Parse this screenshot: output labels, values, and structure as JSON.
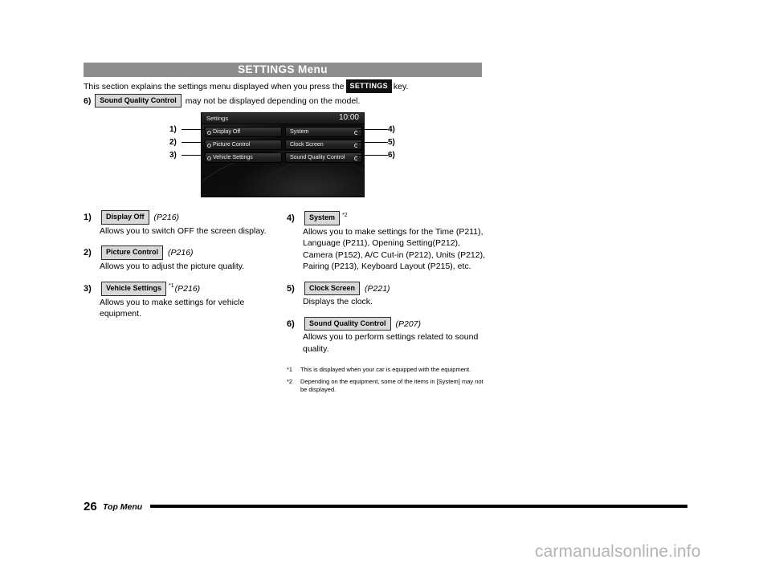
{
  "header": {
    "title": "SETTINGS Menu"
  },
  "intro": {
    "line1_before": "This section explains the settings menu displayed when you press the",
    "key_badge": "SETTINGS",
    "line1_after": "key.",
    "line2_num": "6)",
    "line2_badge": "Sound Quality Control",
    "line2_text": "may not be displayed depending on the model."
  },
  "screen": {
    "title": "Settings",
    "clock": "10:00",
    "left_buttons": [
      {
        "label": "Display Off"
      },
      {
        "label": "Picture Control"
      },
      {
        "label": "Vehicle Settings"
      }
    ],
    "right_buttons": [
      {
        "label": "System"
      },
      {
        "label": "Clock Screen"
      },
      {
        "label": "Sound Quality Control"
      }
    ],
    "callouts_left": [
      "1)",
      "2)",
      "3)"
    ],
    "callouts_right": [
      "4)",
      "5)",
      "6)"
    ]
  },
  "items_left": [
    {
      "num": "1)",
      "badge": "Display Off",
      "sup": "",
      "page_ref": "(P216)",
      "body": "Allows you to switch OFF the screen display."
    },
    {
      "num": "2)",
      "badge": "Picture Control",
      "sup": "",
      "page_ref": "(P216)",
      "body": "Allows you to adjust the picture quality."
    },
    {
      "num": "3)",
      "badge": "Vehicle Settings",
      "sup": "*1",
      "page_ref": "(P216)",
      "body": "Allows you to make settings for vehicle equipment."
    }
  ],
  "items_right": [
    {
      "num": "4)",
      "badge": "System",
      "sup": "*2",
      "page_ref": "",
      "body_html": "Allows you to make settings for the Time (P211), Language (P211), Opening Setting(P212), Camera (P152), A/C Cut-in (P212), Units (P212), Pairing (P213), Keyboard Layout (P215), etc."
    },
    {
      "num": "5)",
      "badge": "Clock Screen",
      "sup": "",
      "page_ref": "(P221)",
      "body_html": "Displays the clock."
    },
    {
      "num": "6)",
      "badge": "Sound Quality Control",
      "sup": "",
      "page_ref": "(P207)",
      "body_html": "Allows you to perform settings related to sound quality."
    }
  ],
  "footnotes": [
    {
      "mark": "*1",
      "text": "This is displayed when your car is equipped with the equipment."
    },
    {
      "mark": "*2",
      "text": "Depending on the equipment, some of the items in [System] may not be displayed."
    }
  ],
  "footer": {
    "page_number": "26",
    "label": "Top Menu"
  },
  "watermark": "carmanualsonline.info",
  "colors": {
    "header_bar": "#8e8e8e",
    "key_badge_bg": "#101010",
    "soft_badge_bg": "#d8d8d8",
    "screen_bg": "#0e0e10",
    "watermark": "#b4b4b4"
  }
}
